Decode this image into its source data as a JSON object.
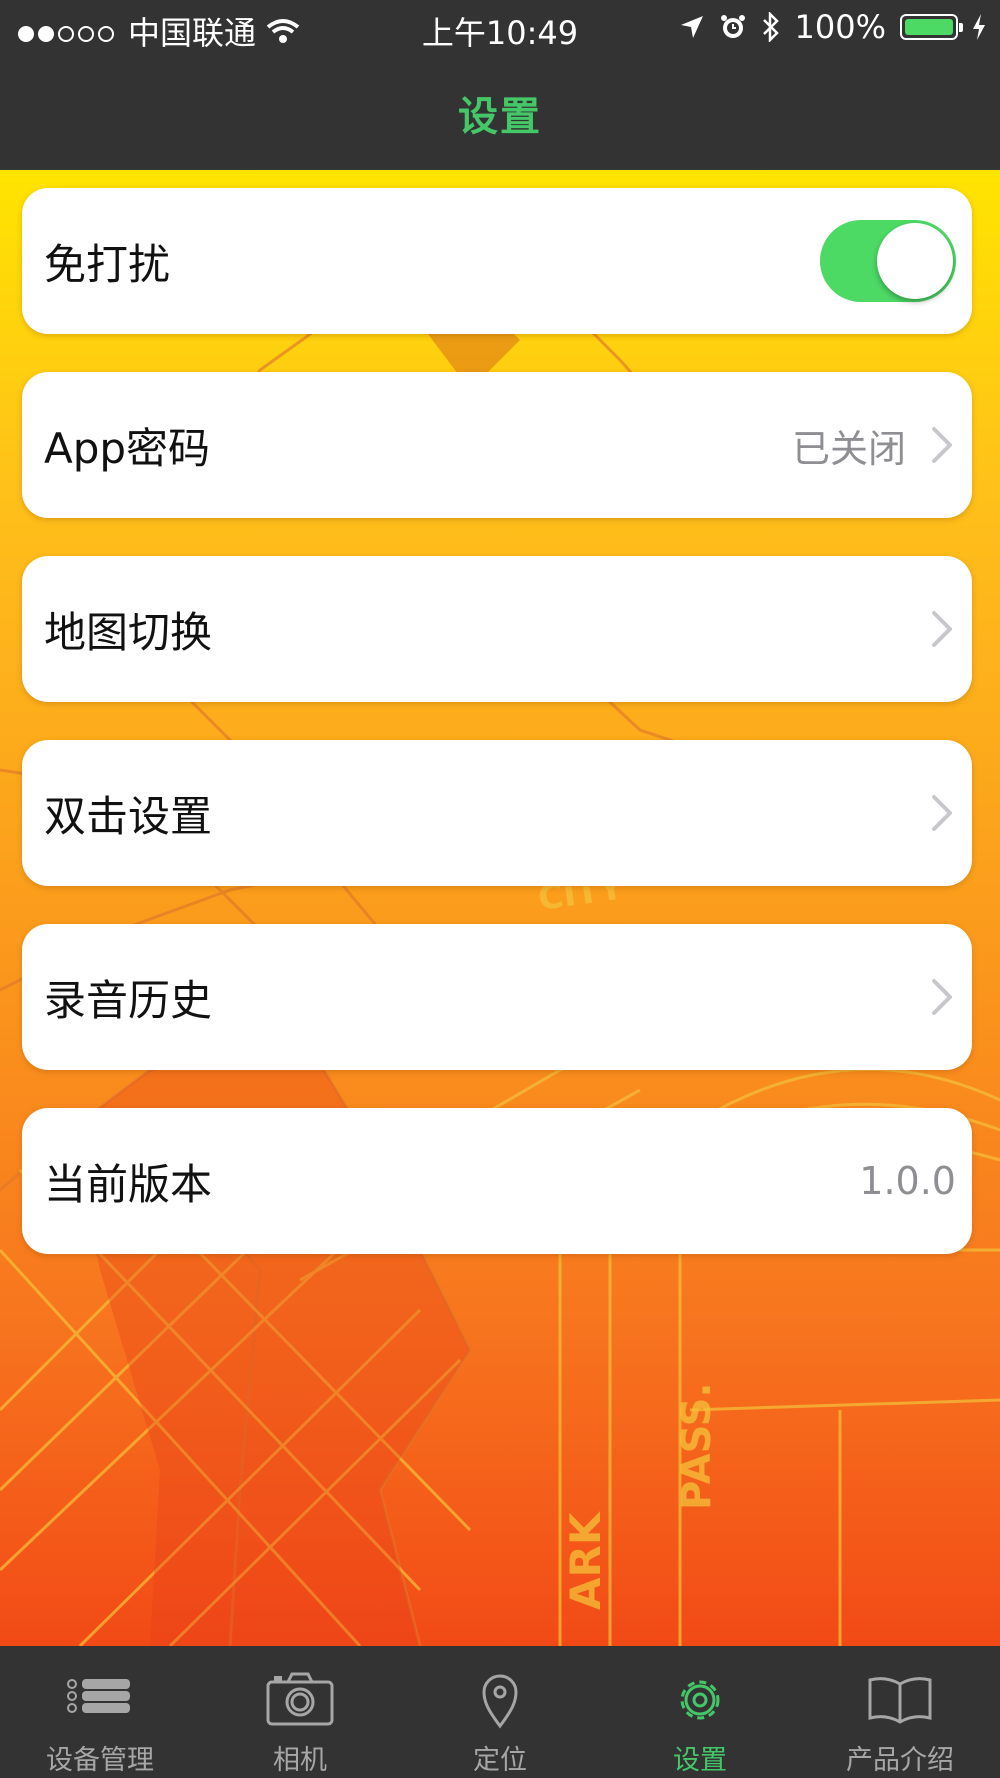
{
  "status_bar": {
    "carrier": "中国联通",
    "time": "上午10:49",
    "battery": "100%",
    "signal_bars_filled": 2,
    "signal_bars_total": 5
  },
  "nav": {
    "title": "设置"
  },
  "colors": {
    "accent": "#44c767",
    "toggle_on": "#4cd964",
    "bar_bg": "#333333"
  },
  "settings": {
    "do_not_disturb": {
      "label": "免打扰",
      "enabled": true
    },
    "app_password": {
      "label": "App密码",
      "value": "已关闭"
    },
    "map_switch": {
      "label": "地图切换"
    },
    "double_click": {
      "label": "双击设置"
    },
    "record_history": {
      "label": "录音历史"
    },
    "version": {
      "label": "当前版本",
      "value": "1.0.0"
    }
  },
  "tabs": [
    {
      "label": "设备管理",
      "icon": "list-icon",
      "active": false
    },
    {
      "label": "相机",
      "icon": "camera-icon",
      "active": false
    },
    {
      "label": "定位",
      "icon": "location-pin-icon",
      "active": false
    },
    {
      "label": "设置",
      "icon": "gear-icon",
      "active": true
    },
    {
      "label": "产品介绍",
      "icon": "book-icon",
      "active": false
    }
  ]
}
